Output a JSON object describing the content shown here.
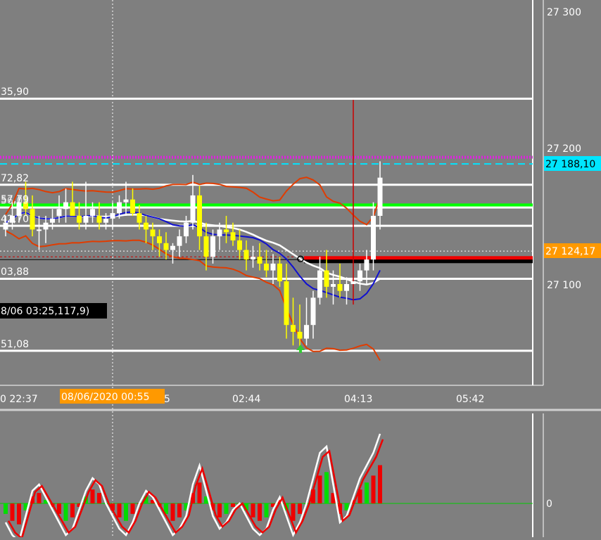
{
  "colors": {
    "background": "#7f7f7f",
    "grid": "#c8c8c8",
    "level_line": "#ffffff",
    "green_line": "#00ff00",
    "magenta_dots": "#e020e0",
    "cyan_dash": "#00e5ff",
    "bollinger": "#e03c00",
    "ma_white": "#ffffff",
    "ma_blue": "#1010d0",
    "candle_up": "#ffffff",
    "candle_down": "#ffff00",
    "osc_up": "#00dd00",
    "osc_down": "#ee0000",
    "orange_tag": "#ff9900",
    "cyan_tag": "#00e5ff"
  },
  "price_axis": {
    "ticks": [
      "27 300",
      "27 200",
      "27 100"
    ],
    "tag_cyan": "27 188,10",
    "tag_orange": "27 124,17"
  },
  "time_axis": {
    "ticks": [
      "0 22:37",
      "5",
      "02:44",
      "04:13",
      "05:42"
    ],
    "tag_orange": "08/06/2020 00:55"
  },
  "level_labels": {
    "l1": "35,90",
    "l2": "72,82",
    "l3a": "57,79",
    "l3b": "56,09",
    "l4": "42,70",
    "l5": "03,88",
    "l6": "51,08"
  },
  "crosshair_label": "8/06 03:25,117,9)",
  "oscillator_axis": {
    "zero_label": "0"
  },
  "chart_data": {
    "type": "candlestick",
    "ylim": [
      27040,
      27330
    ],
    "price_ticks": [
      27300,
      27200,
      27100
    ],
    "horizontal_levels": [
      27235.9,
      27172.82,
      27157.79,
      27156.09,
      27142.7,
      27103.88,
      27051.08
    ],
    "cyan_price": 27188.1,
    "magenta_price": 27193,
    "crosshair_price": 27117.9,
    "current_price": 27124.17,
    "candles": [
      [
        27140,
        27150,
        27135,
        27145
      ],
      [
        27145,
        27160,
        27140,
        27150
      ],
      [
        27150,
        27165,
        27145,
        27160
      ],
      [
        27160,
        27175,
        27150,
        27155
      ],
      [
        27155,
        27165,
        27135,
        27140
      ],
      [
        27140,
        27150,
        27125,
        27140
      ],
      [
        27140,
        27150,
        27130,
        27145
      ],
      [
        27145,
        27155,
        27140,
        27148
      ],
      [
        27150,
        27165,
        27145,
        27155
      ],
      [
        27155,
        27170,
        27145,
        27160
      ],
      [
        27160,
        27175,
        27150,
        27150
      ],
      [
        27150,
        27160,
        27140,
        27145
      ],
      [
        27145,
        27175,
        27140,
        27150
      ],
      [
        27150,
        27160,
        27145,
        27155
      ],
      [
        27150,
        27160,
        27140,
        27145
      ],
      [
        27145,
        27152,
        27140,
        27148
      ],
      [
        27148,
        27160,
        27140,
        27152
      ],
      [
        27152,
        27165,
        27148,
        27160
      ],
      [
        27160,
        27175,
        27150,
        27162
      ],
      [
        27162,
        27170,
        27150,
        27152
      ],
      [
        27152,
        27158,
        27140,
        27145
      ],
      [
        27145,
        27150,
        27130,
        27140
      ],
      [
        27140,
        27145,
        27125,
        27135
      ],
      [
        27135,
        27140,
        27120,
        27130
      ],
      [
        27130,
        27138,
        27118,
        27125
      ],
      [
        27125,
        27130,
        27115,
        27128
      ],
      [
        27128,
        27140,
        27120,
        27135
      ],
      [
        27135,
        27150,
        27130,
        27145
      ],
      [
        27145,
        27180,
        27140,
        27165
      ],
      [
        27165,
        27172,
        27125,
        27135
      ],
      [
        27135,
        27145,
        27110,
        27120
      ],
      [
        27120,
        27140,
        27115,
        27135
      ],
      [
        27135,
        27145,
        27125,
        27140
      ],
      [
        27140,
        27150,
        27130,
        27138
      ],
      [
        27138,
        27145,
        27128,
        27132
      ],
      [
        27132,
        27140,
        27118,
        27125
      ],
      [
        27125,
        27132,
        27110,
        27118
      ],
      [
        27118,
        27128,
        27112,
        27120
      ],
      [
        27120,
        27130,
        27110,
        27115
      ],
      [
        27115,
        27125,
        27105,
        27110
      ],
      [
        27110,
        27122,
        27100,
        27115
      ],
      [
        27115,
        27120,
        27098,
        27102
      ],
      [
        27102,
        27115,
        27060,
        27070
      ],
      [
        27070,
        27090,
        27055,
        27065
      ],
      [
        27065,
        27085,
        27052,
        27060
      ],
      [
        27060,
        27090,
        27055,
        27070
      ],
      [
        27070,
        27095,
        27060,
        27090
      ],
      [
        27090,
        27120,
        27085,
        27110
      ],
      [
        27110,
        27125,
        27090,
        27098
      ],
      [
        27098,
        27110,
        27085,
        27100
      ],
      [
        27100,
        27115,
        27090,
        27095
      ],
      [
        27095,
        27105,
        27085,
        27100
      ],
      [
        27100,
        27235,
        27085,
        27102
      ],
      [
        27102,
        27115,
        27095,
        27110
      ],
      [
        27110,
        27125,
        27100,
        27118
      ],
      [
        27118,
        27160,
        27110,
        27150
      ],
      [
        27150,
        27190,
        27140,
        27178
      ]
    ],
    "oscillator_ylim": [
      -15,
      12
    ]
  }
}
